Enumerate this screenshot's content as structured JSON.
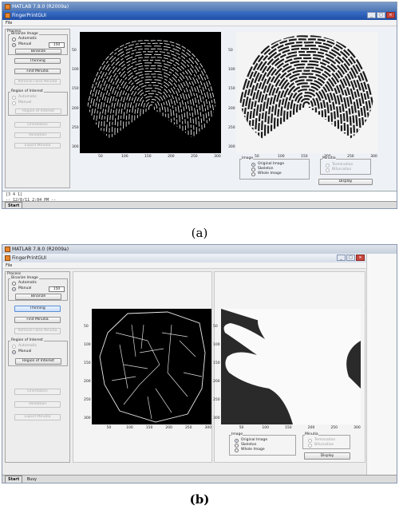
{
  "window_a": {
    "outer_title": "MATLAB 7.8.0 (R2009a)",
    "inner_title": "FingerPrintGUI",
    "menu": [
      "File"
    ],
    "process_label": "Process",
    "binarize_group": "Binarize Image",
    "radio_automatic": "Automatic",
    "radio_manual": "Manual",
    "threshold_value": "150",
    "binarize_button": "Binarize",
    "thinning_button": "Thinning",
    "find_minutiae_button": "Find Minutia",
    "remove_false_button": "Remove False Minutia",
    "roi_group": "Region of Interest",
    "roi_automatic": "Automatic",
    "roi_manual": "Manual",
    "roi_button": "Region of Interest",
    "orientation_button": "Orientation",
    "validation_button": "Validation",
    "export_button": "Export Minutia",
    "image_group": "Image",
    "image_options": [
      "Original Image",
      "Skeleton",
      "Whole Image"
    ],
    "minutia_group": "Minutia",
    "minutia_options": [
      "Termination",
      "Bifurcation"
    ],
    "display_button": "Display",
    "cmd_lines": [
      "[3  4  1]",
      "--  12/8/11  2:04 PM  --"
    ],
    "start_label": "Start",
    "left_axis_x_ticks": [
      "50",
      "100",
      "150",
      "200",
      "250",
      "300"
    ],
    "left_axis_y_ticks": [
      "50",
      "100",
      "150",
      "200",
      "250",
      "300"
    ],
    "right_axis_x_ticks": [
      "50",
      "100",
      "150",
      "200",
      "250",
      "300"
    ],
    "right_axis_y_ticks": [
      "50",
      "100",
      "150",
      "200",
      "250",
      "300"
    ]
  },
  "window_b": {
    "outer_title": "MATLAB 7.8.0 (R2009a)",
    "inner_title": "FingerPrintGUI",
    "menu": [
      "File"
    ],
    "process_label": "Process",
    "binarize_group": "Binarize Image",
    "radio_automatic": "Automatic",
    "radio_manual": "Manual",
    "threshold_value": "150",
    "binarize_button": "Binarize",
    "thinning_button": "Thinning",
    "find_minutiae_button": "Find Minutia",
    "remove_false_button": "Remove False Minutia",
    "roi_group": "Region of Interest",
    "roi_automatic": "Automatic",
    "roi_manual": "Manual",
    "roi_button": "Region of Interest",
    "orientation_button": "Orientation",
    "validation_button": "Validation",
    "export_button": "Export Minutia",
    "image_group": "Image",
    "image_options": [
      "Original Image",
      "Skeleton",
      "Whole Image"
    ],
    "minutia_group": "Minutia",
    "minutia_options": [
      "Termination",
      "Bifurcation"
    ],
    "display_button": "Display",
    "start_label": "Start",
    "status_text": "Busy",
    "left_axis_x_ticks": [
      "50",
      "100",
      "150",
      "200",
      "250",
      "300"
    ],
    "left_axis_y_ticks": [
      "50",
      "100",
      "150",
      "200",
      "250",
      "300"
    ],
    "right_axis_x_ticks": [
      "50",
      "100",
      "150",
      "200",
      "250",
      "300"
    ],
    "right_axis_y_ticks": [
      "50",
      "100",
      "150",
      "200",
      "250",
      "300"
    ]
  },
  "captions": {
    "a": "(a)",
    "b": "(b)"
  },
  "colors": {
    "title_blue": "#2a5cb8",
    "image_black": "#000000"
  }
}
